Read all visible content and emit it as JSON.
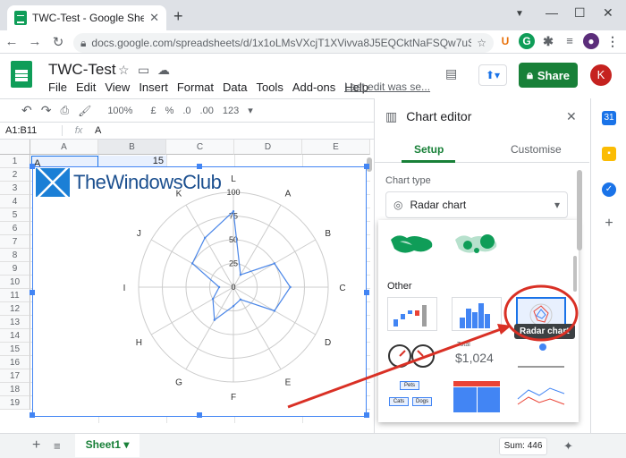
{
  "browser": {
    "tab_title": "TWC-Test - Google Sheets",
    "tab_close": "✕",
    "new_tab": "+",
    "url": "docs.google.com/spreadsheets/d/1x1oLMsVXcjT1XVivva8J5EQCktNaFSQw7uSrtkwU-jg...",
    "win_min": "—",
    "win_max": "☐",
    "win_close": "✕",
    "ext_u": "U",
    "ext_g": "G",
    "profile": "●"
  },
  "sheets": {
    "doc_title": "TWC-Test",
    "menu": [
      "File",
      "Edit",
      "View",
      "Insert",
      "Format",
      "Data",
      "Tools",
      "Add-ons",
      "Help"
    ],
    "last_edit": "Last edit was se...",
    "share_label": "Share",
    "avatar_letter": "K",
    "toolbar": {
      "zoom": "100%",
      "currency": "£",
      "percent": "%",
      "dec1": ".0",
      "dec2": ".00",
      "format": "123"
    },
    "name_box": "A1:B11",
    "formula_value": "A",
    "columns": [
      "A",
      "B",
      "C",
      "D",
      "E"
    ],
    "rows": [
      "1",
      "2",
      "3",
      "4",
      "5",
      "6",
      "7",
      "8",
      "9",
      "10",
      "11",
      "12",
      "13",
      "14",
      "15",
      "16",
      "17",
      "18",
      "19"
    ],
    "cell_a1": "A",
    "cell_b1": "15"
  },
  "chart_watermark": "TheWindowsClub",
  "chart_data": {
    "type": "radar",
    "categories": [
      "A",
      "B",
      "C",
      "D",
      "E",
      "F",
      "G",
      "H",
      "I",
      "J",
      "K",
      "L"
    ],
    "rlim": [
      0,
      100
    ],
    "rticks": [
      "0",
      "25",
      "50",
      "75",
      "100"
    ],
    "series": [
      {
        "values": [
          15,
          50,
          60,
          50,
          15,
          20,
          40,
          25,
          15,
          50,
          60,
          80
        ]
      }
    ],
    "color": "#4a86e8"
  },
  "editor": {
    "title": "Chart editor",
    "tab_setup": "Setup",
    "tab_customise": "Customise",
    "chart_type_label": "Chart type",
    "chart_type_value": "Radar chart",
    "other_label": "Other",
    "tooltip": "Radar chart",
    "scorecard_label": "Total",
    "scorecard_value": "$1,024",
    "orgchart_labels": [
      "Pets",
      "Cats",
      "Dogs"
    ]
  },
  "footer": {
    "add_sheet": "+",
    "sheet_name": "Sheet1",
    "sum": "Sum: 446"
  },
  "colors": {
    "accent": "#1a73e8",
    "share": "#188038",
    "annotation": "#d93025"
  }
}
